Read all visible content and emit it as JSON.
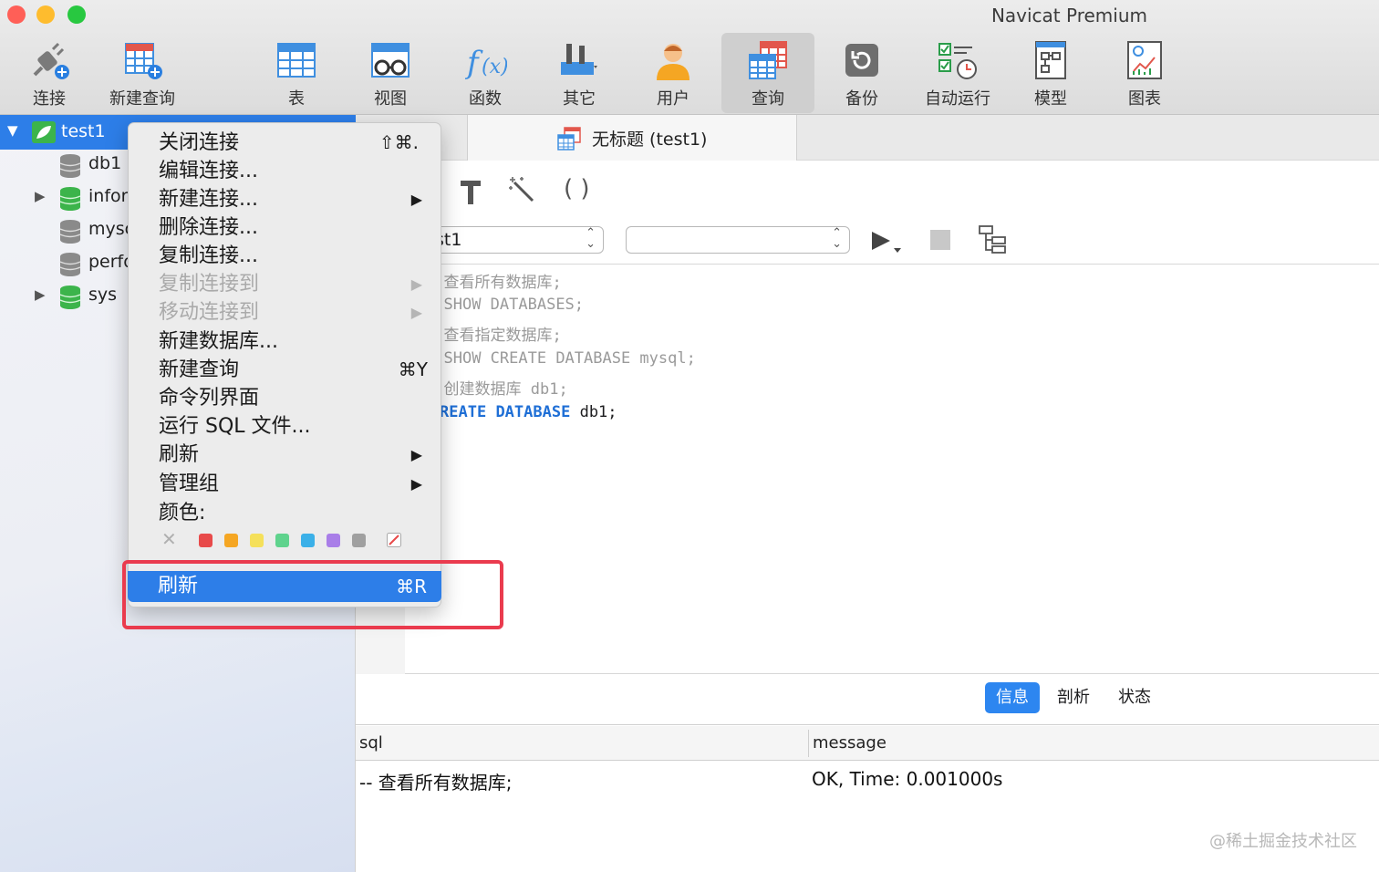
{
  "window": {
    "title": "Navicat Premium",
    "traffic_lights": [
      "#ff5f57",
      "#febc2e",
      "#28c840"
    ]
  },
  "toolbar": {
    "items": [
      {
        "label": "连接",
        "icon": "plug-add-icon"
      },
      {
        "label": "新建查询",
        "icon": "table-add-icon"
      },
      {
        "label": "表",
        "icon": "table-icon"
      },
      {
        "label": "视图",
        "icon": "view-glasses-icon"
      },
      {
        "label": "函数",
        "icon": "function-icon"
      },
      {
        "label": "其它",
        "icon": "tools-icon"
      },
      {
        "label": "用户",
        "icon": "user-icon"
      },
      {
        "label": "查询",
        "icon": "query-icon",
        "active": true
      },
      {
        "label": "备份",
        "icon": "backup-icon"
      },
      {
        "label": "自动运行",
        "icon": "schedule-icon"
      },
      {
        "label": "模型",
        "icon": "model-icon"
      },
      {
        "label": "图表",
        "icon": "chart-icon"
      }
    ]
  },
  "sidebar": {
    "connection": "test1",
    "databases": [
      {
        "name": "db1",
        "color": "gray",
        "expandable": false
      },
      {
        "name": "infor",
        "color": "green",
        "expandable": true
      },
      {
        "name": "mysc",
        "color": "gray",
        "expandable": false
      },
      {
        "name": "perfo",
        "color": "gray",
        "expandable": false
      },
      {
        "name": "sys",
        "color": "green",
        "expandable": true
      }
    ]
  },
  "context_menu": {
    "items": [
      {
        "label": "关闭连接",
        "shortcut": "⇧⌘."
      },
      {
        "label": "编辑连接..."
      },
      {
        "label": "新建连接...",
        "submenu": true
      },
      {
        "label": "删除连接..."
      },
      {
        "label": "复制连接..."
      },
      {
        "label": "复制连接到",
        "submenu": true,
        "disabled": true
      },
      {
        "label": "移动连接到",
        "submenu": true,
        "disabled": true
      },
      {
        "label": "新建数据库..."
      },
      {
        "label": "新建查询",
        "shortcut": "⌘Y"
      },
      {
        "label": "命令列界面"
      },
      {
        "label": "运行 SQL 文件..."
      },
      {
        "label": "刷新",
        "submenu": true
      },
      {
        "label": "管理组",
        "submenu": true
      }
    ],
    "color_label": "颜色:",
    "colors": [
      "#e84a4a",
      "#f5a623",
      "#f5e05a",
      "#5fd38d",
      "#3bb0e8",
      "#a97ee8",
      "#a0a0a0"
    ],
    "highlighted": {
      "label": "刷新",
      "shortcut": "⌘R"
    }
  },
  "editor": {
    "tab_title": "无标题 (test1)",
    "connection_select": "test1",
    "database_select": "",
    "connection_select_visible": "st1",
    "lines": [
      {
        "dash": "-",
        "text": "查看所有数据库;",
        "kind": "comment"
      },
      {
        "dash": "-",
        "text": "SHOW DATABASES;",
        "kind": "comment"
      },
      {
        "dash": "-",
        "text": "查看指定数据库;",
        "kind": "comment"
      },
      {
        "dash": "-",
        "text": "SHOW CREATE DATABASE mysql;",
        "kind": "comment"
      },
      {
        "dash": "-",
        "text": "创建数据库 db1;",
        "kind": "comment"
      }
    ],
    "last_line": {
      "kw1": "REATE",
      "kw2": "DATABASE",
      "rest": "db1;"
    }
  },
  "results": {
    "tabs": [
      "信息",
      "剖析",
      "状态"
    ],
    "active_tab": "信息",
    "columns": [
      "sql",
      "message"
    ],
    "rows": [
      {
        "sql": "-- 查看所有数据库;",
        "message": "OK, Time: 0.001000s"
      }
    ]
  },
  "watermark": "@稀土掘金技术社区"
}
